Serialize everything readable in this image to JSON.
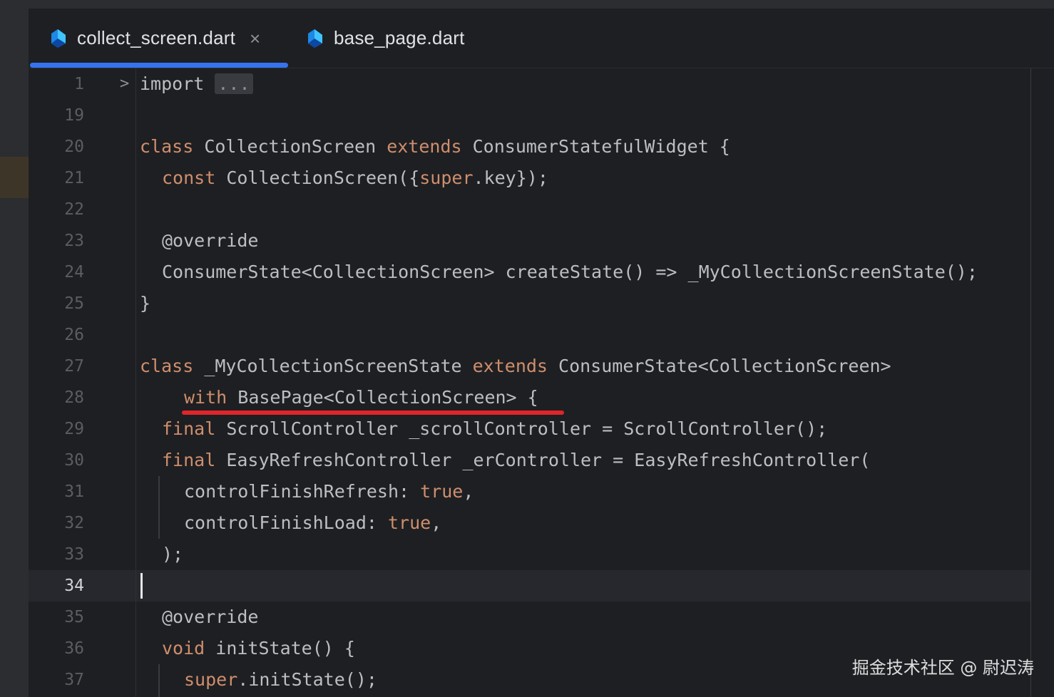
{
  "tabs": [
    {
      "label": "collect_screen.dart",
      "active": true,
      "close": "×"
    },
    {
      "label": "base_page.dart",
      "active": false
    }
  ],
  "colors": {
    "accent": "#3574f0",
    "keyword": "#cf8e6d",
    "text": "#bcbec4",
    "highlight_underline": "#e0252b"
  },
  "editor": {
    "current_line": "34",
    "line_numbers": [
      "1",
      "19",
      "20",
      "21",
      "22",
      "23",
      "24",
      "25",
      "26",
      "27",
      "28",
      "29",
      "30",
      "31",
      "32",
      "33",
      "34",
      "35",
      "36",
      "37"
    ],
    "folded_placeholder": "...",
    "lines": {
      "l1_import": "import",
      "l20_kw1": "class",
      "l20_t1": " CollectionScreen ",
      "l20_kw2": "extends",
      "l20_t2": " ConsumerStatefulWidget {",
      "l21_kw": "const",
      "l21_t1": " CollectionScreen({",
      "l21_kw2": "super",
      "l21_t2": ".key});",
      "l23": "@override",
      "l24": "ConsumerState<CollectionScreen> createState() => _MyCollectionScreenState();",
      "l25": "}",
      "l27_kw1": "class",
      "l27_t1": " _MyCollectionScreenState ",
      "l27_kw2": "extends",
      "l27_t2": " ConsumerState<CollectionScreen>",
      "l28_kw": "with",
      "l28_t": " BasePage<CollectionScreen> {",
      "l29_kw": "final",
      "l29_t": " ScrollController _scrollController = ScrollController();",
      "l30_kw": "final",
      "l30_t": " EasyRefreshController _erController = EasyRefreshController(",
      "l31_t": "controlFinishRefresh: ",
      "l31_kw": "true",
      "l31_end": ",",
      "l32_t": "controlFinishLoad: ",
      "l32_kw": "true",
      "l32_end": ",",
      "l33": ");",
      "l35": "@override",
      "l36_kw": "void",
      "l36_t": " initState() {",
      "l37_kw": "super",
      "l37_t": ".initState();"
    }
  },
  "watermark": "掘金技术社区 @ 尉迟涛"
}
